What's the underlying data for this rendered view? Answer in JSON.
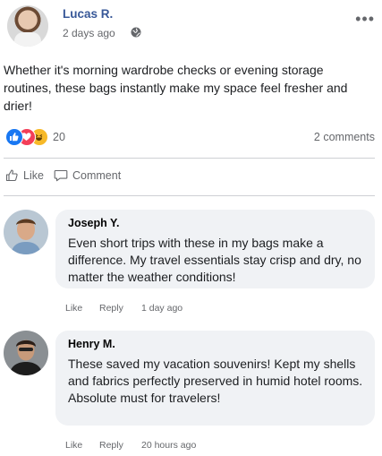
{
  "post": {
    "author": "Lucas R.",
    "time": "2 days ago",
    "text": "Whether it's morning wardrobe checks or evening storage routines, these bags instantly make my space feel fresher and drier!",
    "reactions_count": "20",
    "comments_count": "2 comments"
  },
  "actions": {
    "like_label": "Like",
    "comment_label": "Comment"
  },
  "comments": [
    {
      "name": "Joseph Y.",
      "text": "Even short trips with these in my bags make a difference. My travel essentials stay crisp and dry, no matter the weather conditions!",
      "like_label": "Like",
      "reply_label": "Reply",
      "time": "1 day ago"
    },
    {
      "name": "Henry M.",
      "text": "These saved my vacation souvenirs!  Kept my shells and fabrics perfectly preserved in humid hotel rooms. Absolute must for travelers!",
      "like_label": "Like",
      "reply_label": "Reply",
      "time": "20 hours ago"
    }
  ],
  "colors": {
    "author": "#385898",
    "like_blue": "#1877f2",
    "love_red": "#f33e58",
    "haha_yellow": "#f7b928",
    "bubble_bg": "#f0f2f5"
  }
}
